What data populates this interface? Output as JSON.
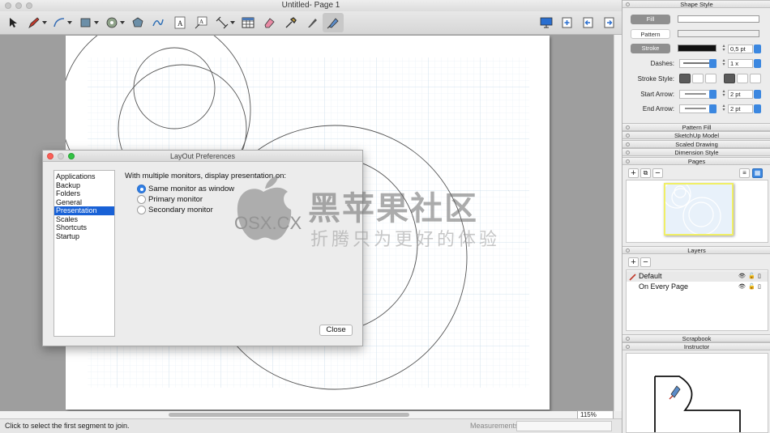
{
  "window": {
    "title": "Untitled- Page 1"
  },
  "status": {
    "hint": "Click to select the first segment to join.",
    "measurements_label": "Measurements",
    "zoom": "115%"
  },
  "preferences": {
    "title": "LayOut Preferences",
    "categories": [
      "Applications",
      "Backup",
      "Folders",
      "General",
      "Presentation",
      "Scales",
      "Shortcuts",
      "Startup"
    ],
    "selected_category": "Presentation",
    "heading": "With multiple monitors, display presentation on:",
    "options": [
      "Same monitor as window",
      "Primary monitor",
      "Secondary monitor"
    ],
    "selected_option": "Same monitor as window",
    "close_label": "Close"
  },
  "panel": {
    "shape_style": {
      "title": "Shape Style",
      "fill_label": "Fill",
      "pattern_label": "Pattern",
      "stroke_label": "Stroke",
      "stroke_width": "0,5 pt",
      "dashes_label": "Dashes:",
      "dash_scale": "1 x",
      "stroke_style_label": "Stroke Style:",
      "start_arrow_label": "Start Arrow:",
      "start_arrow_size": "2 pt",
      "end_arrow_label": "End Arrow:",
      "end_arrow_size": "2 pt"
    },
    "sections": {
      "pattern_fill": "Pattern Fill",
      "sketchup_model": "SketchUp Model",
      "scaled_drawing": "Scaled Drawing",
      "dimension_style": "Dimension Style",
      "pages": "Pages",
      "layers": "Layers",
      "scrapbook": "Scrapbook",
      "instructor": "Instructor"
    },
    "layers": [
      "Default",
      "On Every Page"
    ]
  },
  "watermark": {
    "brand": "黑苹果社区",
    "domain": "OSX.CX",
    "slogan": "折腾只为更好的体验"
  },
  "colors": {
    "accent": "#1861d6",
    "canvas_bg": "#9e9e9e",
    "grid": "#d6e6f2"
  }
}
